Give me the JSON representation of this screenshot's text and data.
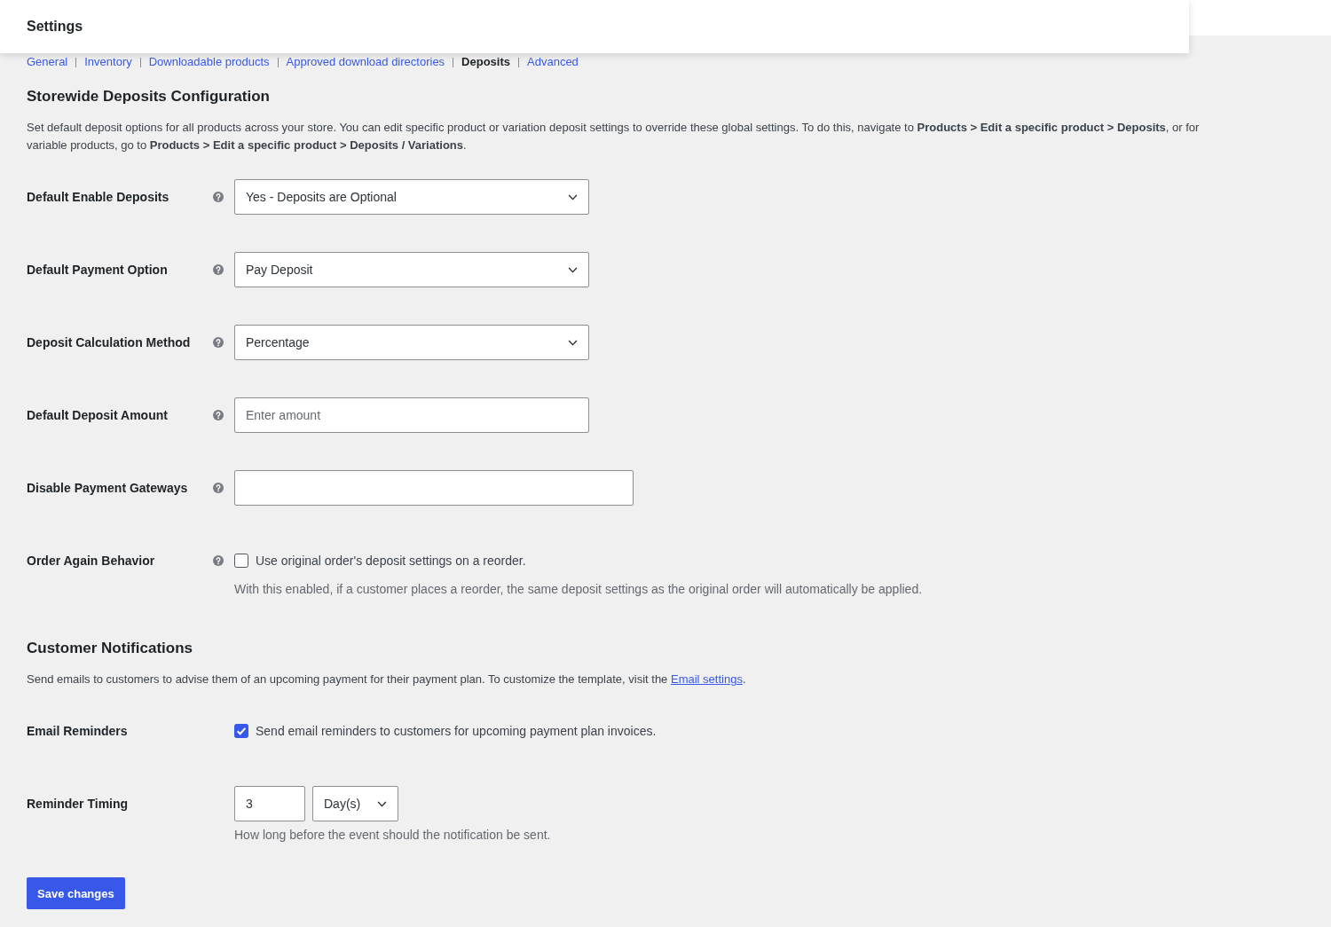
{
  "header": {
    "title": "Settings"
  },
  "tabs": [
    {
      "label": "General",
      "selected": false
    },
    {
      "label": "Inventory",
      "selected": false
    },
    {
      "label": "Downloadable products",
      "selected": false
    },
    {
      "label": "Approved download directories",
      "selected": false
    },
    {
      "label": "Deposits",
      "selected": true
    },
    {
      "label": "Advanced",
      "selected": false
    }
  ],
  "sections": [
    {
      "title": "Storewide Deposits Configuration",
      "description": [
        {
          "kind": "text",
          "text": "Set default deposit options for all products across your store. You can edit specific product or variation deposit settings to override these global settings. To do this, navigate to **Products > Edit a specific product > Deposits**, or for variable products, go to **Products > Edit a specific product > Deposits / Variations**."
        }
      ],
      "fields": [
        {
          "label": "Default Enable Deposits",
          "help": true,
          "kind": "select",
          "value": "Yes - Deposits are Optional"
        },
        {
          "label": "Default Payment Option",
          "help": true,
          "kind": "select",
          "value": "Pay Deposit"
        },
        {
          "label": "Deposit Calculation Method",
          "help": true,
          "kind": "select",
          "value": "Percentage"
        },
        {
          "label": "Default Deposit Amount",
          "help": true,
          "kind": "text",
          "placeholder": "Enter amount"
        },
        {
          "label": "Disable Payment Gateways",
          "help": true,
          "kind": "multiselect"
        },
        {
          "label": "Order Again Behavior",
          "help": true,
          "kind": "checkbox",
          "checked": false,
          "option": "Use original order's deposit settings on a reorder.",
          "description": "With this enabled, if a customer places a reorder, the same deposit settings as the original order will automatically be applied."
        }
      ]
    },
    {
      "title": "Customer Notifications",
      "description": [
        {
          "kind": "text",
          "text": "Send emails to customers to advise them of an upcoming payment for their payment plan. To customize the template, visit the "
        },
        {
          "kind": "link",
          "text": "Email settings"
        },
        {
          "kind": "text",
          "text": "."
        }
      ],
      "fields": [
        {
          "label": "Email Reminders",
          "help": false,
          "kind": "checkbox",
          "checked": true,
          "option": "Send email reminders to customers for upcoming payment plan invoices."
        },
        {
          "label": "Reminder Timing",
          "help": false,
          "kind": "number_unit",
          "value": "3",
          "unit": "Day(s)",
          "description": "How long before the event should the notification be sent."
        }
      ]
    }
  ],
  "save_button": "Save changes"
}
